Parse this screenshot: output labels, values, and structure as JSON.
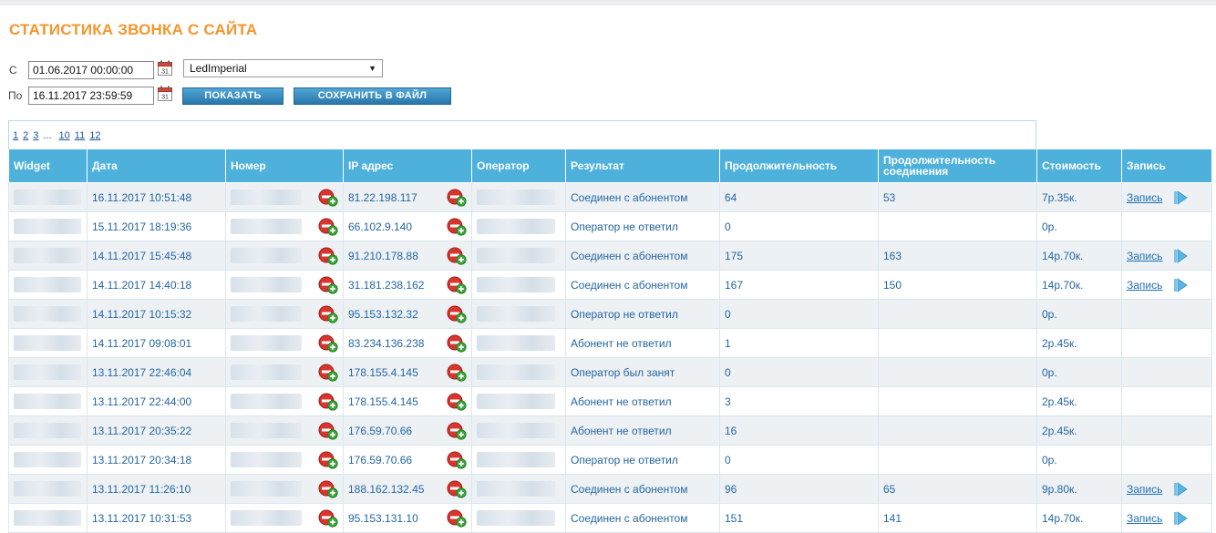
{
  "page": {
    "title": "СТАТИСТИКА ЗВОНКА С САЙТА"
  },
  "filters": {
    "from_label": "С",
    "to_label": "По",
    "from_value": "01.06.2017 00:00:00",
    "to_value": "16.11.2017 23:59:59",
    "site_value": "LedImperial",
    "show_button": "ПОКАЗАТЬ",
    "save_button": "СОХРАНИТЬ В ФАЙЛ"
  },
  "pager": {
    "pages": [
      "1",
      "2",
      "3"
    ],
    "ellipsis": "...",
    "pages_end": [
      "10",
      "11",
      "12"
    ]
  },
  "table": {
    "headers": {
      "widget": "Widget",
      "date": "Дата",
      "number": "Номер",
      "ip": "IP адрес",
      "operator": "Оператор",
      "result": "Результат",
      "duration": "Продолжительность",
      "conn_duration": "Продолжительность соединения",
      "cost": "Стоимость",
      "record": "Запись"
    },
    "record_link": "Запись",
    "rows": [
      {
        "date": "16.11.2017 10:51:48",
        "ip": "81.22.198.117",
        "result": "Соединен с абонентом",
        "duration": "64",
        "conn": "53",
        "cost": "7р.35к.",
        "record": true
      },
      {
        "date": "15.11.2017 18:19:36",
        "ip": "66.102.9.140",
        "result": "Оператор не ответил",
        "duration": "0",
        "conn": "",
        "cost": "0р.",
        "record": false
      },
      {
        "date": "14.11.2017 15:45:48",
        "ip": "91.210.178.88",
        "result": "Соединен с абонентом",
        "duration": "175",
        "conn": "163",
        "cost": "14р.70к.",
        "record": true
      },
      {
        "date": "14.11.2017 14:40:18",
        "ip": "31.181.238.162",
        "result": "Соединен с абонентом",
        "duration": "167",
        "conn": "150",
        "cost": "14р.70к.",
        "record": true
      },
      {
        "date": "14.11.2017 10:15:32",
        "ip": "95.153.132.32",
        "result": "Оператор не ответил",
        "duration": "0",
        "conn": "",
        "cost": "0р.",
        "record": false
      },
      {
        "date": "14.11.2017 09:08:01",
        "ip": "83.234.136.238",
        "result": "Абонент не ответил",
        "duration": "1",
        "conn": "",
        "cost": "2р.45к.",
        "record": false
      },
      {
        "date": "13.11.2017 22:46:04",
        "ip": "178.155.4.145",
        "result": "Оператор был занят",
        "duration": "0",
        "conn": "",
        "cost": "0р.",
        "record": false
      },
      {
        "date": "13.11.2017 22:44:00",
        "ip": "178.155.4.145",
        "result": "Абонент не ответил",
        "duration": "3",
        "conn": "",
        "cost": "2р.45к.",
        "record": false
      },
      {
        "date": "13.11.2017 20:35:22",
        "ip": "176.59.70.66",
        "result": "Абонент не ответил",
        "duration": "16",
        "conn": "",
        "cost": "2р.45к.",
        "record": false
      },
      {
        "date": "13.11.2017 20:34:18",
        "ip": "176.59.70.66",
        "result": "Оператор не ответил",
        "duration": "0",
        "conn": "",
        "cost": "0р.",
        "record": false
      },
      {
        "date": "13.11.2017 11:26:10",
        "ip": "188.162.132.45",
        "result": "Соединен с абонентом",
        "duration": "96",
        "conn": "65",
        "cost": "9р.80к.",
        "record": true
      },
      {
        "date": "13.11.2017 10:31:53",
        "ip": "95.153.131.10",
        "result": "Соединен с абонентом",
        "duration": "151",
        "conn": "141",
        "cost": "14р.70к.",
        "record": true
      }
    ]
  },
  "colors": {
    "title": "#f4962b",
    "header_bg": "#4db1dc",
    "link": "#2466a3",
    "button": "#2e86bf"
  },
  "icons": {
    "calendar": "calendar-icon",
    "block_add": "block-add-icon",
    "play": "play-icon"
  }
}
